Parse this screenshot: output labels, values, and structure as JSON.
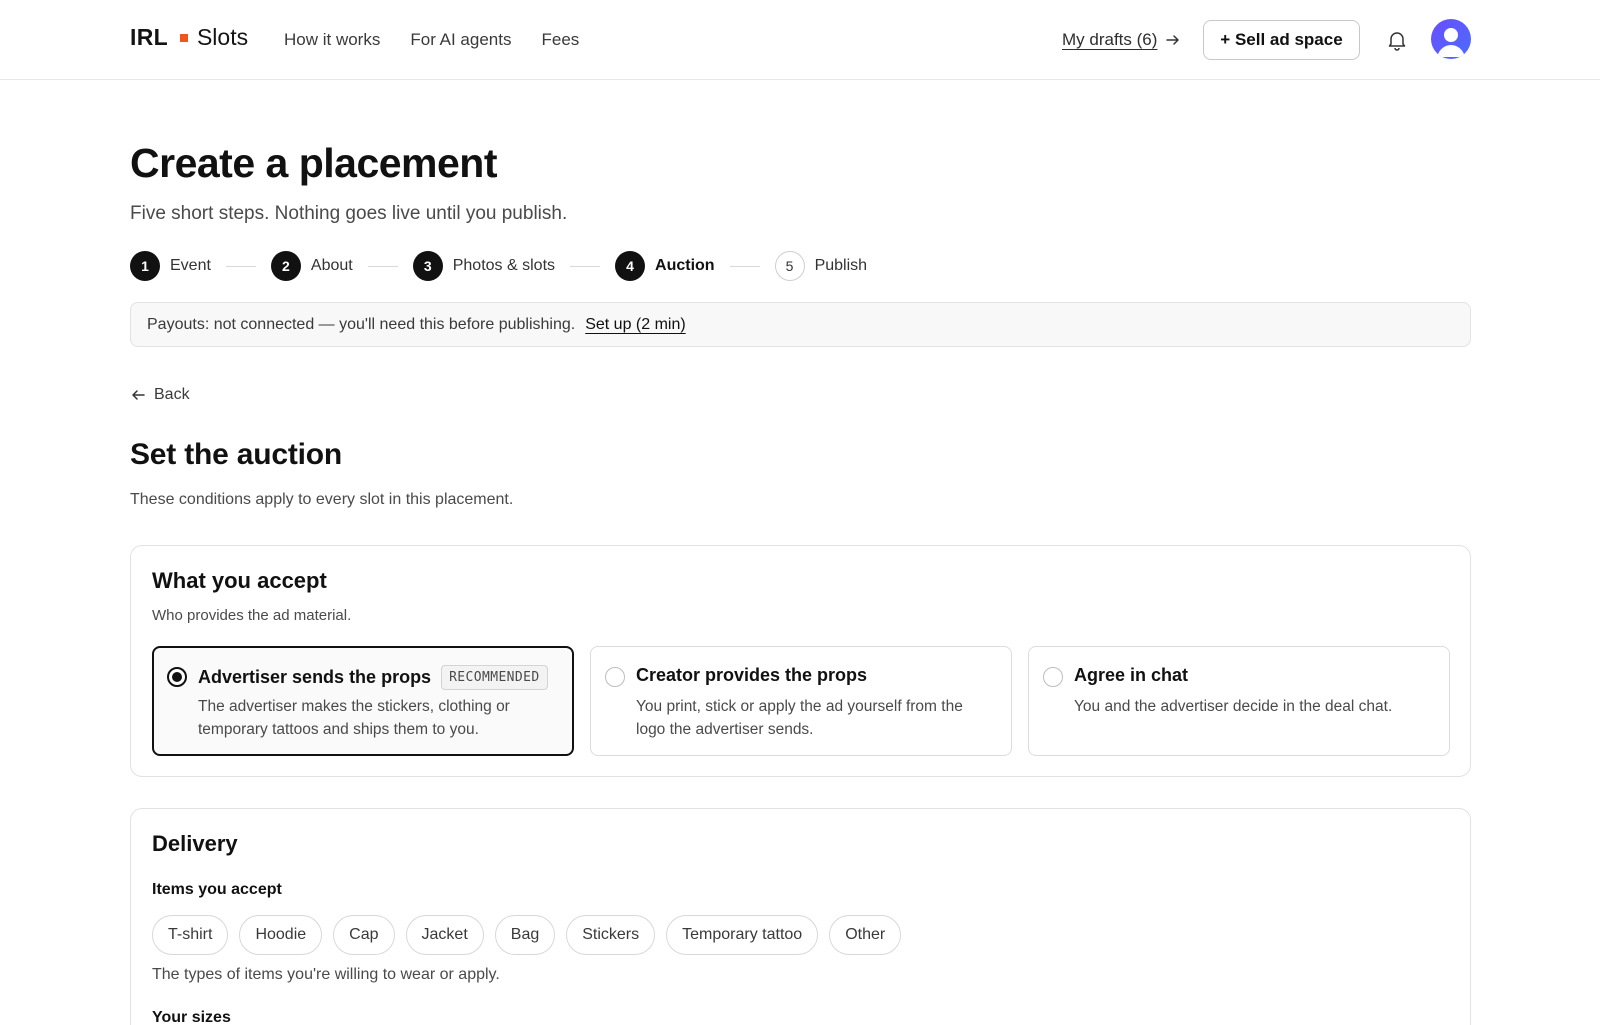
{
  "header": {
    "logo_left": "IRL",
    "logo_right": "Slots",
    "nav": [
      "How it works",
      "For AI agents",
      "Fees"
    ],
    "drafts_label": "My drafts (6)",
    "sell_button": "+ Sell ad space",
    "accent_color": "#f0551e"
  },
  "page": {
    "title": "Create a placement",
    "subtitle": "Five short steps. Nothing goes live until you publish."
  },
  "stepper": {
    "steps": [
      {
        "num": "1",
        "label": "Event",
        "state": "done"
      },
      {
        "num": "2",
        "label": "About",
        "state": "done"
      },
      {
        "num": "3",
        "label": "Photos & slots",
        "state": "done"
      },
      {
        "num": "4",
        "label": "Auction",
        "state": "current"
      },
      {
        "num": "5",
        "label": "Publish",
        "state": "upcoming"
      }
    ]
  },
  "payout": {
    "text": "Payouts: not connected — you'll need this before publishing.",
    "link": "Set up (2 min)"
  },
  "back_label": "Back",
  "section": {
    "title": "Set the auction",
    "subtitle": "These conditions apply to every slot in this placement."
  },
  "accept": {
    "title": "What you accept",
    "subtitle": "Who provides the ad material.",
    "options": [
      {
        "title": "Advertiser sends the props",
        "badge": "RECOMMENDED",
        "desc": "The advertiser makes the stickers, clothing or temporary tattoos and ships them to you.",
        "selected": true
      },
      {
        "title": "Creator provides the props",
        "badge": "",
        "desc": "You print, stick or apply the ad yourself from the logo the advertiser sends.",
        "selected": false
      },
      {
        "title": "Agree in chat",
        "badge": "",
        "desc": "You and the advertiser decide in the deal chat.",
        "selected": false
      }
    ]
  },
  "delivery": {
    "title": "Delivery",
    "items_label": "Items you accept",
    "items": [
      "T-shirt",
      "Hoodie",
      "Cap",
      "Jacket",
      "Bag",
      "Stickers",
      "Temporary tattoo",
      "Other"
    ],
    "items_help": "The types of items you're willing to wear or apply.",
    "sizes_label": "Your sizes"
  }
}
